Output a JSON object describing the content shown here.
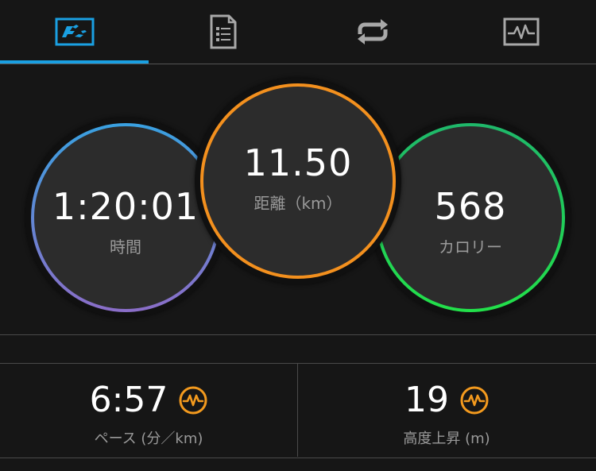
{
  "tabs": [
    {
      "name": "overview",
      "icon": "running-stats-icon",
      "active": true
    },
    {
      "name": "details",
      "icon": "document-list-icon",
      "active": false
    },
    {
      "name": "laps",
      "icon": "loop-arrows-icon",
      "active": false
    },
    {
      "name": "charts",
      "icon": "activity-graph-icon",
      "active": false
    }
  ],
  "colors": {
    "accent": "#1aa0e2",
    "time_ring_top": "#3aa0e0",
    "time_ring_bottom": "#8a6ec8",
    "distance_ring": "#f3901e",
    "calories_ring": "#22d060",
    "badge": "#f39a1e"
  },
  "summary": {
    "time": {
      "value": "1:20:01",
      "label": "時間"
    },
    "distance": {
      "value": "11.50",
      "label": "距離（km）"
    },
    "calories": {
      "value": "568",
      "label": "カロリー"
    }
  },
  "metrics": {
    "pace": {
      "value": "6:57",
      "label": "ペース (分／km)",
      "icon": "heart-rate-badge-icon"
    },
    "elevation": {
      "value": "19",
      "label": "高度上昇 (m)",
      "icon": "heart-rate-badge-icon"
    }
  }
}
